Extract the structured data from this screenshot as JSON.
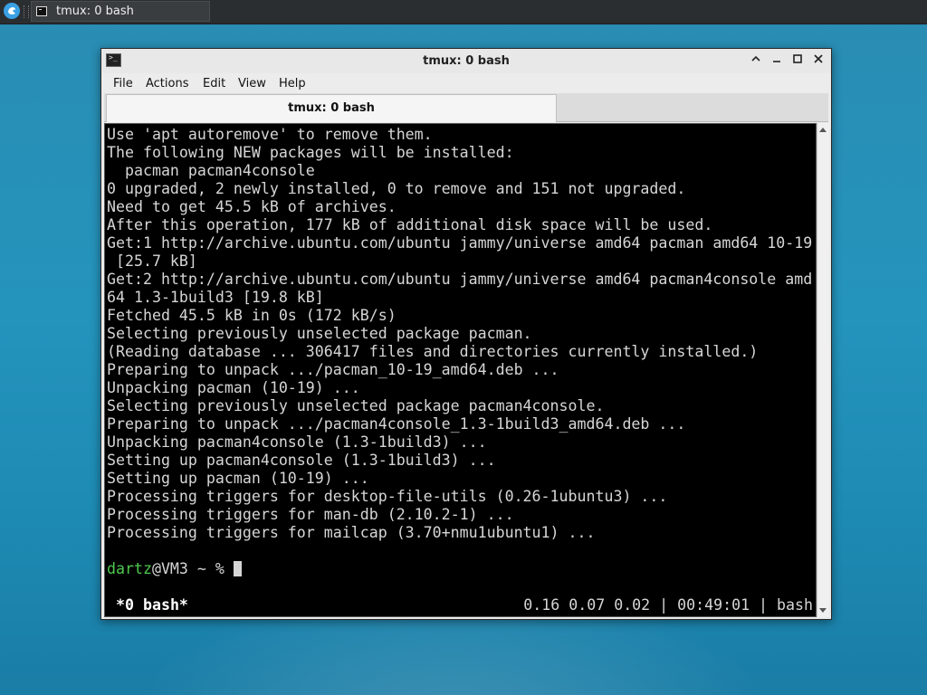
{
  "taskbar": {
    "menu_icon": "app-menu-icon",
    "task_title": "tmux: 0 bash"
  },
  "window": {
    "title": "tmux: 0 bash",
    "icon": "terminal-icon",
    "buttons": {
      "shade": "⌃",
      "minimize": "_",
      "maximize": "□",
      "close": "✕"
    }
  },
  "menubar": {
    "items": [
      {
        "label": "File"
      },
      {
        "label": "Actions"
      },
      {
        "label": "Edit"
      },
      {
        "label": "View"
      },
      {
        "label": "Help"
      }
    ]
  },
  "tabs": [
    {
      "label": "tmux: 0 bash",
      "active": true
    }
  ],
  "terminal": {
    "lines": [
      "Use 'apt autoremove' to remove them.",
      "The following NEW packages will be installed:",
      "  pacman pacman4console",
      "0 upgraded, 2 newly installed, 0 to remove and 151 not upgraded.",
      "Need to get 45.5 kB of archives.",
      "After this operation, 177 kB of additional disk space will be used.",
      "Get:1 http://archive.ubuntu.com/ubuntu jammy/universe amd64 pacman amd64 10-19",
      " [25.7 kB]",
      "Get:2 http://archive.ubuntu.com/ubuntu jammy/universe amd64 pacman4console amd",
      "64 1.3-1build3 [19.8 kB]",
      "Fetched 45.5 kB in 0s (172 kB/s)",
      "Selecting previously unselected package pacman.",
      "(Reading database ... 306417 files and directories currently installed.)",
      "Preparing to unpack .../pacman_10-19_amd64.deb ...",
      "Unpacking pacman (10-19) ...",
      "Selecting previously unselected package pacman4console.",
      "Preparing to unpack .../pacman4console_1.3-1build3_amd64.deb ...",
      "Unpacking pacman4console (1.3-1build3) ...",
      "Setting up pacman4console (1.3-1build3) ...",
      "Setting up pacman (10-19) ...",
      "Processing triggers for desktop-file-utils (0.26-1ubuntu3) ...",
      "Processing triggers for man-db (2.10.2-1) ...",
      "Processing triggers for mailcap (3.70+nmu1ubuntu1) ..."
    ],
    "prompt": {
      "user": "dartz",
      "rest": "@VM3 ~ % "
    },
    "status": {
      "left": "*0 bash*",
      "right": "0.16 0.07 0.02 | 00:49:01 | bash"
    },
    "colors": {
      "background": "#000000",
      "text": "#d6d6d6",
      "prompt_user": "#4ec94e"
    }
  }
}
